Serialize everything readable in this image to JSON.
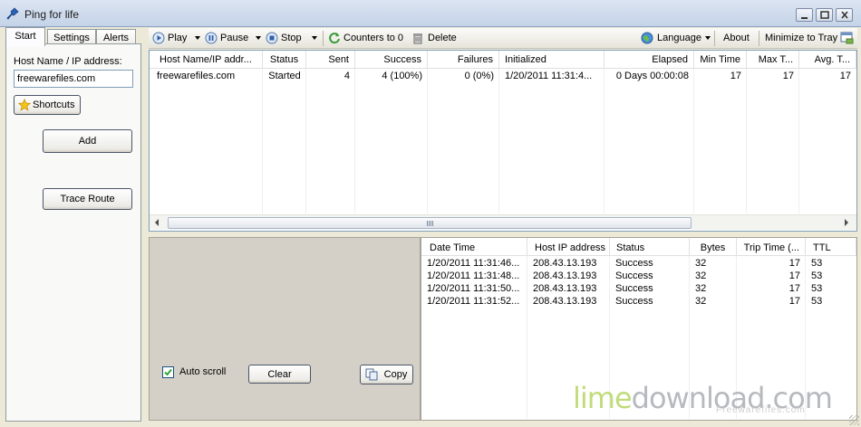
{
  "window": {
    "title": "Ping for life"
  },
  "tabs": [
    {
      "label": "Start",
      "active": true
    },
    {
      "label": "Settings",
      "active": false
    },
    {
      "label": "Alerts",
      "active": false
    }
  ],
  "start_panel": {
    "host_label": "Host Name / IP address:",
    "host_value": "freewarefiles.com",
    "shortcuts_label": "Shortcuts",
    "add_label": "Add",
    "trace_route_label": "Trace Route"
  },
  "toolbar": {
    "play": "Play",
    "pause": "Pause",
    "stop": "Stop",
    "counters": "Counters to 0",
    "delete": "Delete",
    "language": "Language",
    "about": "About",
    "minimize": "Minimize to Tray"
  },
  "hosts_table": {
    "columns": [
      "Host Name/IP addr...",
      "Status",
      "Sent",
      "Success",
      "Failures",
      "Initialized",
      "Elapsed",
      "Min Time",
      "Max T...",
      "Avg. T..."
    ],
    "rows": [
      [
        "freewarefiles.com",
        "Started",
        "4",
        "4 (100%)",
        "0 (0%)",
        "1/20/2011 11:31:4...",
        "0 Days 00:00:08",
        "17",
        "17",
        "17"
      ]
    ]
  },
  "log_controls": {
    "auto_scroll_label": "Auto scroll",
    "auto_scroll_checked": true,
    "clear_label": "Clear",
    "copy_label": "Copy"
  },
  "log_table": {
    "columns": [
      "Date Time",
      "Host IP address",
      "Status",
      "Bytes",
      "Trip Time (...",
      "TTL"
    ],
    "rows": [
      [
        "1/20/2011 11:31:46...",
        "208.43.13.193",
        "Success",
        "32",
        "17",
        "53"
      ],
      [
        "1/20/2011 11:31:48...",
        "208.43.13.193",
        "Success",
        "32",
        "17",
        "53"
      ],
      [
        "1/20/2011 11:31:50...",
        "208.43.13.193",
        "Success",
        "32",
        "17",
        "53"
      ],
      [
        "1/20/2011 11:31:52...",
        "208.43.13.193",
        "Success",
        "32",
        "17",
        "53"
      ]
    ]
  },
  "watermark": {
    "part1": "lime",
    "part2": "download.com",
    "sub": "Freewarefiles.com"
  },
  "colors": {
    "accent_green": "#a8cf48",
    "frame": "#ece9d8",
    "border_blue": "#7f9db9"
  }
}
